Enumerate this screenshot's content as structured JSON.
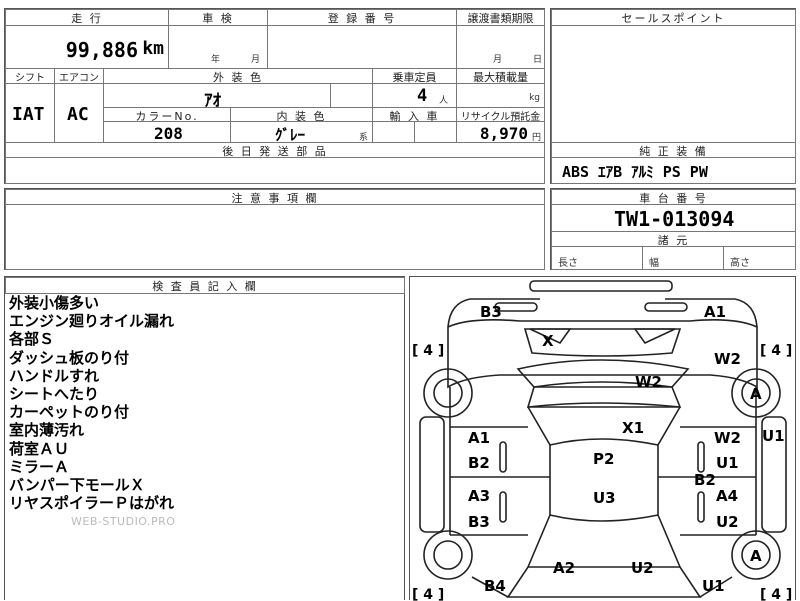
{
  "headers": {
    "mileage": "走 行",
    "shaken": "車 検",
    "registration": "登 録 番 号",
    "transfer_deadline": "譲渡書類期限",
    "sales_point": "セールスポイント",
    "shift": "シフト",
    "aircon": "エアコン",
    "exterior_color": "外 装 色",
    "capacity": "乗車定員",
    "max_load": "最大積載量",
    "color_no": "カラーNo.",
    "interior_color": "内 装 色",
    "import": "輸 入 車",
    "recycle": "リサイクル預託金",
    "later_parts": "後 日 発 送 部 品",
    "equipment": "純 正 装 備",
    "notes": "注 意 事 項 欄",
    "chassis": "車 台 番 号",
    "specs": "諸 元",
    "inspector": "検 査 員 記 入 欄"
  },
  "values": {
    "mileage": "99,886",
    "mileage_unit": "km",
    "year_label": "年",
    "month_label": "月",
    "deadline_month": "月",
    "deadline_day": "日",
    "shift": "IAT",
    "aircon": "AC",
    "exterior_color": "ｱｵ",
    "capacity": "4",
    "capacity_unit": "人",
    "load_unit": "kg",
    "color_no": "208",
    "interior_color": "ｸﾞﾚｰ",
    "interior_suffix": "系",
    "recycle": "8,970",
    "recycle_unit": "円",
    "equipment": "ABS ｴｱB ｱﾙﾐ PS PW",
    "chassis": "TW1-013094",
    "length_label": "長さ",
    "width_label": "幅",
    "height_label": "高さ"
  },
  "inspector_notes": [
    "外装小傷多い",
    "エンジン廻りオイル漏れ",
    "各部Ｓ",
    "ダッシュ板のり付",
    "ハンドルすれ",
    "シートへたり",
    "カーペットのり付",
    "室内薄汚れ",
    "荷室ＡＵ",
    "ミラーＡ",
    "バンパー下モールＸ",
    "リヤスポイラーＰはがれ"
  ],
  "watermark": "WEB-STUDIO.PRO",
  "diagram": {
    "marks": [
      "B3",
      "A1",
      "X",
      "W2",
      "W2",
      "A",
      "A",
      "U1",
      "X1",
      "A1",
      "W2",
      "B2",
      "P2",
      "U1",
      "B2",
      "A3",
      "U3",
      "A4",
      "B3",
      "U2",
      "A2",
      "U2",
      "B4",
      "U1"
    ],
    "tire_labels": [
      "[ 4 ]",
      "[ 4 ]",
      "[ 4 ]",
      "[ 4 ]"
    ]
  }
}
